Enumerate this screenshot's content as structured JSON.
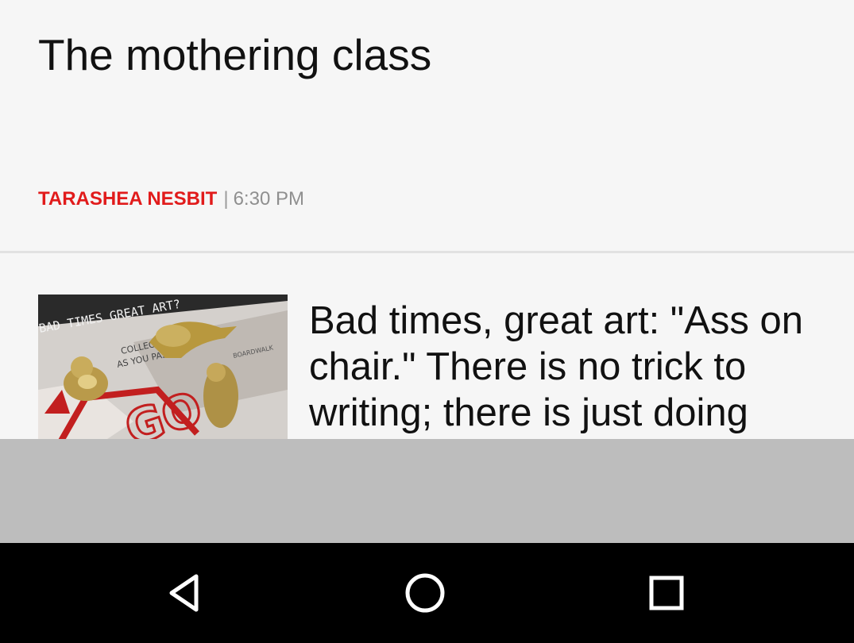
{
  "article": {
    "title": "The mothering class",
    "author": "TARASHEA NESBIT",
    "separator": "|",
    "time": "6:30 PM"
  },
  "next_story": {
    "headline": "Bad times, great art: \"Ass on chair.\" There is no trick to writing; there is just doing",
    "thumbnail_text": {
      "banner": "BAD TIMES GREAT ART?",
      "go": "GO",
      "collect": "COLLECT",
      "as_you_pass": "AS YOU PASS",
      "boardwalk": "BOARDWALK"
    }
  },
  "colors": {
    "background": "#f6f6f6",
    "author_red": "#e11b1b",
    "grey_band": "#bdbdbd",
    "nav_bar": "#000000"
  },
  "navigation": {
    "back_icon": "triangle-back-icon",
    "home_icon": "circle-home-icon",
    "recent_icon": "square-recent-apps-icon"
  }
}
